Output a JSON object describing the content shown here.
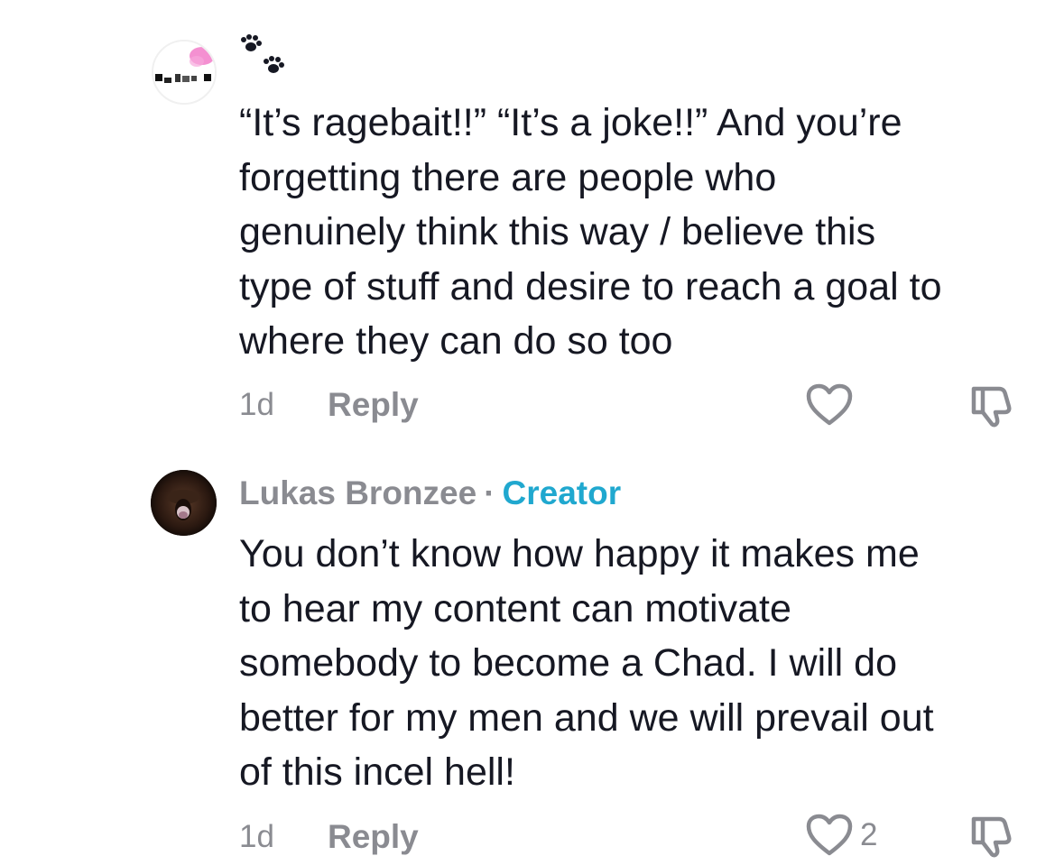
{
  "comments": [
    {
      "username_icon": "paw-prints-icon",
      "text": "“It’s ragebait!!” “It’s a joke!!” And you’re\nforgetting there are people who\ngenuinely think this way / believe this\ntype of stuff and desire to reach a goal to\nwhere they can do so too",
      "time": "1d",
      "reply_label": "Reply",
      "like_count": "",
      "is_creator": false
    },
    {
      "username": "Lukas Bronzee",
      "separator": "·",
      "badge": "Creator",
      "text": "You don’t know how happy it makes me\nto hear my content can motivate\nsomebody to become a Chad. I will do\nbetter for my men and we will prevail out\nof this incel hell!",
      "time": "1d",
      "reply_label": "Reply",
      "like_count": "2",
      "is_creator": true
    }
  ],
  "colors": {
    "muted": "#8a8b91",
    "text": "#161823",
    "creator_badge": "#20a8cf",
    "background": "#ffffff"
  }
}
